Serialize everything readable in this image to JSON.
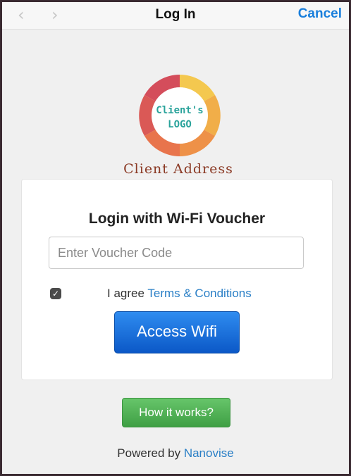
{
  "topbar": {
    "back_icon": "chevron-left-icon",
    "forward_icon": "chevron-right-icon",
    "title": "Log In",
    "cancel_label": "Cancel"
  },
  "logo": {
    "line1": "Client's",
    "line2": "LOGO"
  },
  "client_address": "Client Address",
  "login_card": {
    "title": "Login with Wi-Fi Voucher",
    "voucher_placeholder": "Enter Voucher Code",
    "voucher_value": "",
    "agree_checked": true,
    "agree_text": "I agree",
    "terms_link": "Terms & Conditions",
    "access_label": "Access Wifi"
  },
  "how_label": "How it works?",
  "powered": {
    "text": "Powered by",
    "brand": "Nanovise"
  },
  "colors": {
    "link": "#1a7fdc",
    "primary_button": "#0b58c7",
    "secondary_button": "#3f9f44",
    "address": "#8b3a25"
  }
}
